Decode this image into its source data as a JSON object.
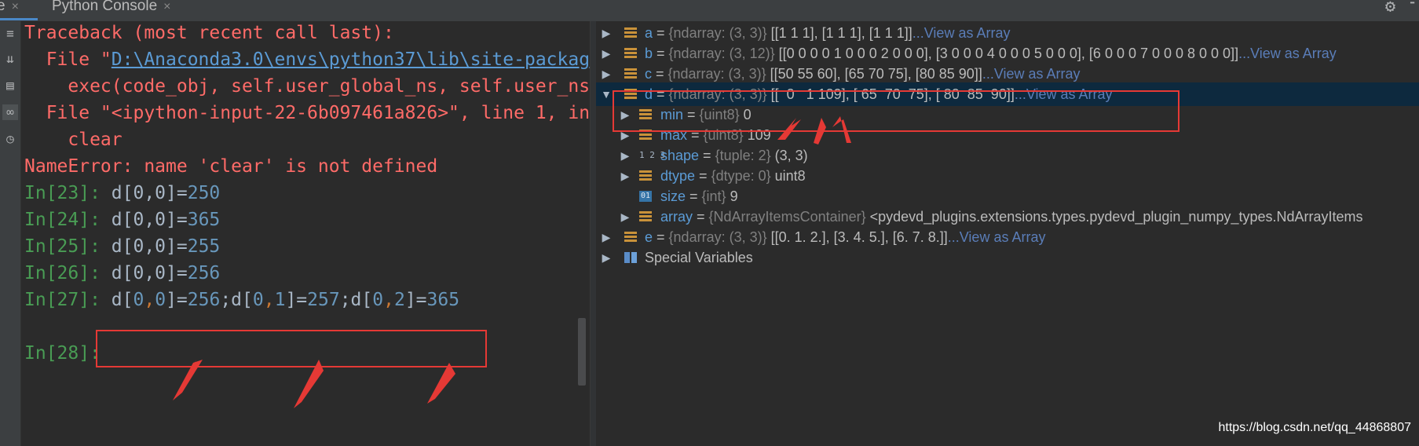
{
  "tabs": {
    "left_fragment": "e",
    "python_console": "Python Console",
    "close_glyph": "×"
  },
  "console": {
    "traceback": "Traceback (most recent call last):",
    "file1_pre": "  File \"",
    "file1_link": "D:\\Anaconda3.0\\envs\\python37\\lib\\site-packag",
    "exec_line": "    exec(code_obj, self.user_global_ns, self.user_ns",
    "file2": "  File \"<ipython-input-22-6b097461a826>\", line 1, in",
    "clear_line": "    clear",
    "name_error": "NameError: name 'clear' is not defined",
    "entries": [
      {
        "prompt": "In[23]:",
        "expr": "d[0,0]=",
        "value": "250"
      },
      {
        "prompt": "In[24]:",
        "expr": "d[0,0]=",
        "value": "365"
      },
      {
        "prompt": "In[25]:",
        "expr": "d[0,0]=",
        "value": "255"
      },
      {
        "prompt": "In[26]:",
        "expr": "d[0,0]=",
        "value": "256"
      }
    ],
    "in27_prompt": "In[27]:",
    "in27_parts": [
      "d[",
      "0",
      ",",
      "0",
      "]=",
      "256",
      ";d[",
      "0",
      ",",
      "1",
      "]=",
      "257",
      ";d[",
      "0",
      ",",
      "2",
      "]=",
      "365"
    ],
    "in28_prompt": "In[28]:"
  },
  "variables": [
    {
      "name": "a",
      "type": "{ndarray: (3, 3)}",
      "value": "[[1 1 1], [1 1 1], [1 1 1]]",
      "link": "...View as Array"
    },
    {
      "name": "b",
      "type": "{ndarray: (3, 12)}",
      "value": "[[0 0 0 0 1 0 0 0 2 0 0 0], [3 0 0 0 4 0 0 0 5 0 0 0], [6 0 0 0 7 0 0 0 8 0 0 0]]",
      "link": "...View as Array"
    },
    {
      "name": "c",
      "type": "{ndarray: (3, 3)}",
      "value": "[[50 55 60], [65 70 75], [80 85 90]]",
      "link": "...View as Array"
    },
    {
      "name": "d",
      "type": "{ndarray: (3, 3)}",
      "value": "[[  0   1 109], [ 65  70  75], [ 80  85  90]]",
      "link": "...View as Array"
    },
    {
      "name": "min",
      "type": "{uint8}",
      "value": "0"
    },
    {
      "name": "max",
      "type": "{uint8}",
      "value": "109"
    },
    {
      "name": "shape",
      "type": "{tuple: 2}",
      "value": "(3, 3)"
    },
    {
      "name": "dtype",
      "type": "{dtype: 0}",
      "value": "uint8"
    },
    {
      "name": "size",
      "type": "{int}",
      "value": "9"
    },
    {
      "name": "array",
      "type": "{NdArrayItemsContainer}",
      "value": "<pydevd_plugins.extensions.types.pydevd_plugin_numpy_types.NdArrayItems"
    },
    {
      "name": "e",
      "type": "{ndarray: (3, 3)}",
      "value": "[[0. 1. 2.], [3. 4. 5.], [6. 7. 8.]]",
      "link": "...View as Array"
    }
  ],
  "special_variables": "Special Variables",
  "eq": " = ",
  "icons": {
    "int_badge": "01",
    "tuple_badge": "1 2 3",
    "gear": "gear-icon",
    "expand": "expand-arrow-icon",
    "collapse": "collapse-arrow-icon"
  },
  "watermark": "https://blog.csdn.net/qq_44868807",
  "colors": {
    "error": "#ff6b68",
    "prompt": "#499c54",
    "number": "#6897bb",
    "highlight_box": "#e53935",
    "selected_row": "#0d293e"
  }
}
